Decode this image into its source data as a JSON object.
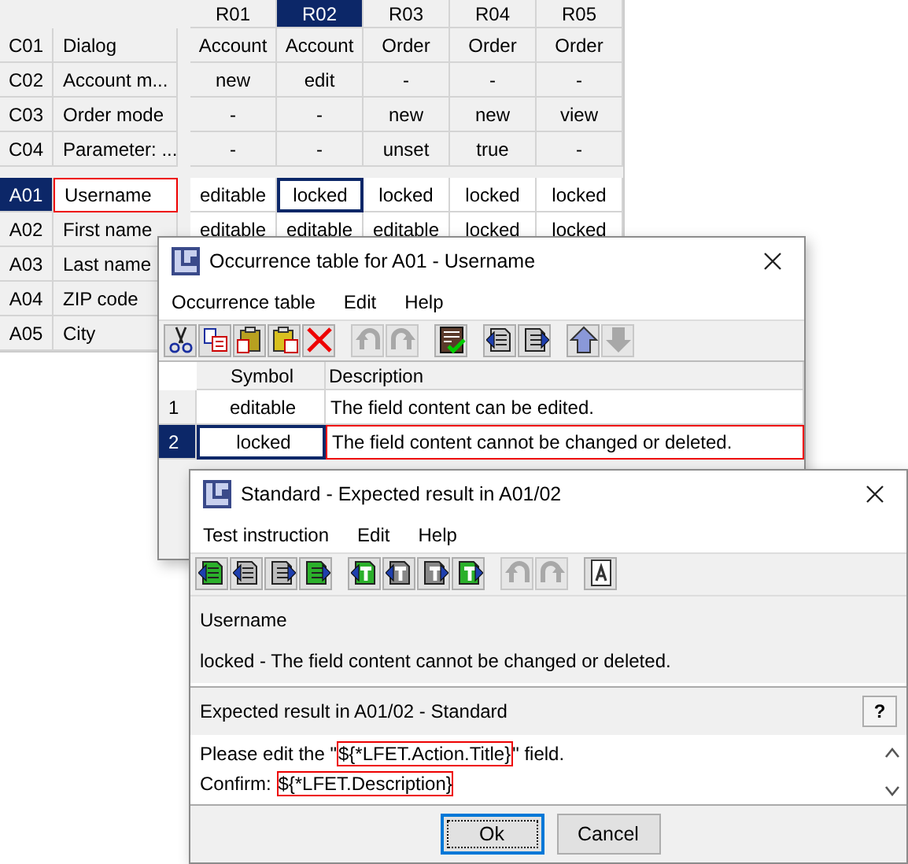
{
  "table": {
    "columns": [
      {
        "label": "R01",
        "selected": false
      },
      {
        "label": "R02",
        "selected": true
      },
      {
        "label": "R03",
        "selected": false
      },
      {
        "label": "R04",
        "selected": false
      },
      {
        "label": "R05",
        "selected": false
      }
    ],
    "conditions": [
      {
        "id": "C01",
        "name": "Dialog",
        "cells": [
          "Account",
          "Account",
          "Order",
          "Order",
          "Order"
        ]
      },
      {
        "id": "C02",
        "name": "Account m...",
        "cells": [
          "new",
          "edit",
          "-",
          "-",
          "-"
        ]
      },
      {
        "id": "C03",
        "name": "Order mode",
        "cells": [
          "-",
          "-",
          "new",
          "new",
          "view"
        ]
      },
      {
        "id": "C04",
        "name": "Parameter: ...",
        "cells": [
          "-",
          "-",
          "unset",
          "true",
          "-"
        ]
      }
    ],
    "actions": [
      {
        "id": "A01",
        "name": "Username",
        "selected": true,
        "cells": [
          {
            "text": "editable",
            "selected": false
          },
          {
            "text": "locked",
            "selected": true
          },
          {
            "text": "locked",
            "selected": false
          },
          {
            "text": "locked",
            "selected": false
          },
          {
            "text": "locked",
            "selected": false
          }
        ]
      },
      {
        "id": "A02",
        "name": "First name",
        "selected": false,
        "cells": [
          {
            "text": "editable",
            "selected": false
          },
          {
            "text": "editable",
            "selected": false
          },
          {
            "text": "editable",
            "selected": false
          },
          {
            "text": "locked",
            "selected": false
          },
          {
            "text": "locked",
            "selected": false
          }
        ]
      },
      {
        "id": "A03",
        "name": "Last name",
        "selected": false
      },
      {
        "id": "A04",
        "name": "ZIP code",
        "selected": false
      },
      {
        "id": "A05",
        "name": "City",
        "selected": false
      }
    ]
  },
  "occurrence_window": {
    "title": "Occurrence table for A01 - Username",
    "menu": [
      "Occurrence table",
      "Edit",
      "Help"
    ],
    "toolbar": [
      {
        "kind": "cut",
        "disabled": false
      },
      {
        "kind": "copy",
        "disabled": false
      },
      {
        "kind": "paste",
        "disabled": false
      },
      {
        "kind": "paste-special",
        "disabled": false
      },
      {
        "kind": "delete",
        "disabled": false
      },
      {
        "kind": "separator"
      },
      {
        "kind": "undo",
        "disabled": true
      },
      {
        "kind": "redo",
        "disabled": true
      },
      {
        "kind": "separator"
      },
      {
        "kind": "check",
        "disabled": false
      },
      {
        "kind": "separator"
      },
      {
        "kind": "insert-before",
        "disabled": false
      },
      {
        "kind": "insert-after",
        "disabled": false
      },
      {
        "kind": "separator"
      },
      {
        "kind": "up",
        "disabled": false
      },
      {
        "kind": "down",
        "disabled": true
      }
    ],
    "columns": [
      "Symbol",
      "Description"
    ],
    "rows": [
      {
        "number": "1",
        "symbol": "editable",
        "description": "The field content can be edited.",
        "selected": false
      },
      {
        "number": "2",
        "symbol": "locked",
        "description": "The field content cannot be changed or deleted.",
        "selected": true
      }
    ]
  },
  "result_window": {
    "title": "Standard - Expected result in A01/02",
    "menu": [
      "Test instruction",
      "Edit",
      "Help"
    ],
    "toolbar": [
      {
        "kind": "page-first",
        "disabled": false
      },
      {
        "kind": "page-prev",
        "disabled": false
      },
      {
        "kind": "page-next",
        "disabled": false
      },
      {
        "kind": "page-last",
        "disabled": false
      },
      {
        "kind": "separator"
      },
      {
        "kind": "title-first",
        "disabled": false
      },
      {
        "kind": "title-prev",
        "disabled": false
      },
      {
        "kind": "title-next",
        "disabled": false
      },
      {
        "kind": "title-last",
        "disabled": false
      },
      {
        "kind": "separator"
      },
      {
        "kind": "undo",
        "disabled": true
      },
      {
        "kind": "redo",
        "disabled": true
      },
      {
        "kind": "separator"
      },
      {
        "kind": "text-page",
        "disabled": false
      }
    ],
    "info": [
      "Username",
      "locked - The field content cannot be changed or deleted."
    ],
    "section_title": "Expected result in A01/02 - Standard",
    "help_button": "?",
    "text_lines": [
      [
        {
          "text": "Please edit the \"",
          "marked": false
        },
        {
          "text": "${*LFET.Action.Title}",
          "marked": true
        },
        {
          "text": "\" field.",
          "marked": false
        }
      ],
      [
        {
          "text": "Confirm: ",
          "marked": false
        },
        {
          "text": "${*LFET.Description}",
          "marked": true
        }
      ]
    ],
    "buttons": [
      {
        "label": "Ok",
        "default": true
      },
      {
        "label": "Cancel",
        "default": false
      }
    ]
  }
}
